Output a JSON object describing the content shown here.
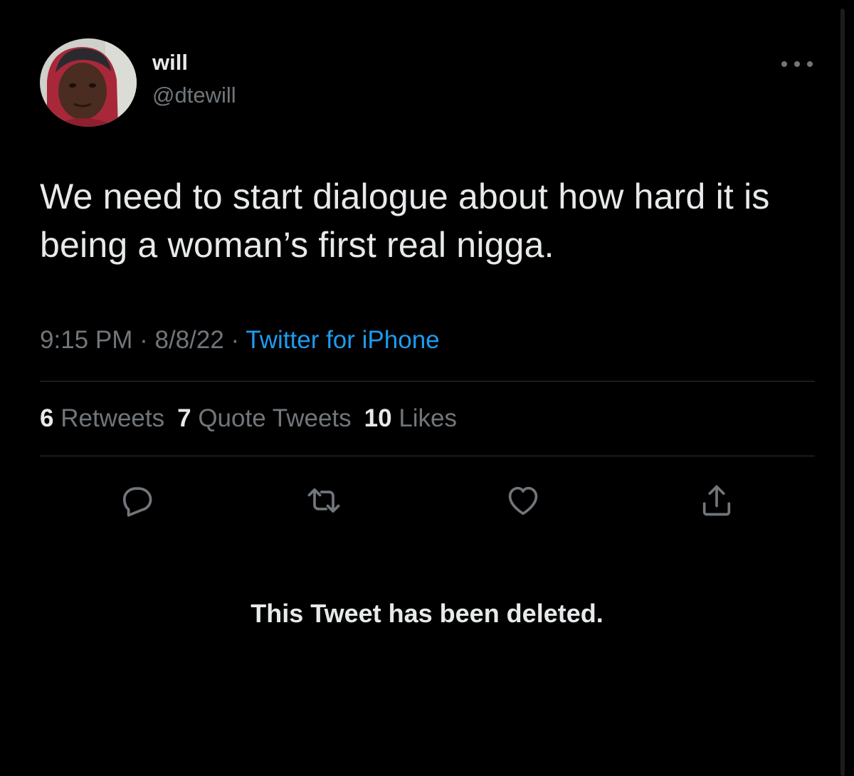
{
  "tweet": {
    "author": {
      "display_name": "will",
      "handle": "@dtewill"
    },
    "text": "We need to start dialogue about how hard it is being a woman’s first real nigga.",
    "time": "9:15 PM",
    "separator": "·",
    "date": "8/8/22",
    "source": "Twitter for iPhone",
    "stats": {
      "retweets_count": "6",
      "retweets_label": "Retweets",
      "quotes_count": "7",
      "quotes_label": "Quote Tweets",
      "likes_count": "10",
      "likes_label": "Likes"
    },
    "actions": [
      "reply-icon",
      "retweet-icon",
      "like-icon",
      "share-icon"
    ]
  },
  "deleted_notice": "This Tweet has been deleted.",
  "colors": {
    "background": "#000000",
    "primary_text": "#e7e9ea",
    "secondary_text": "#71767b",
    "link": "#1d9bf0",
    "divider": "#2f3336"
  }
}
